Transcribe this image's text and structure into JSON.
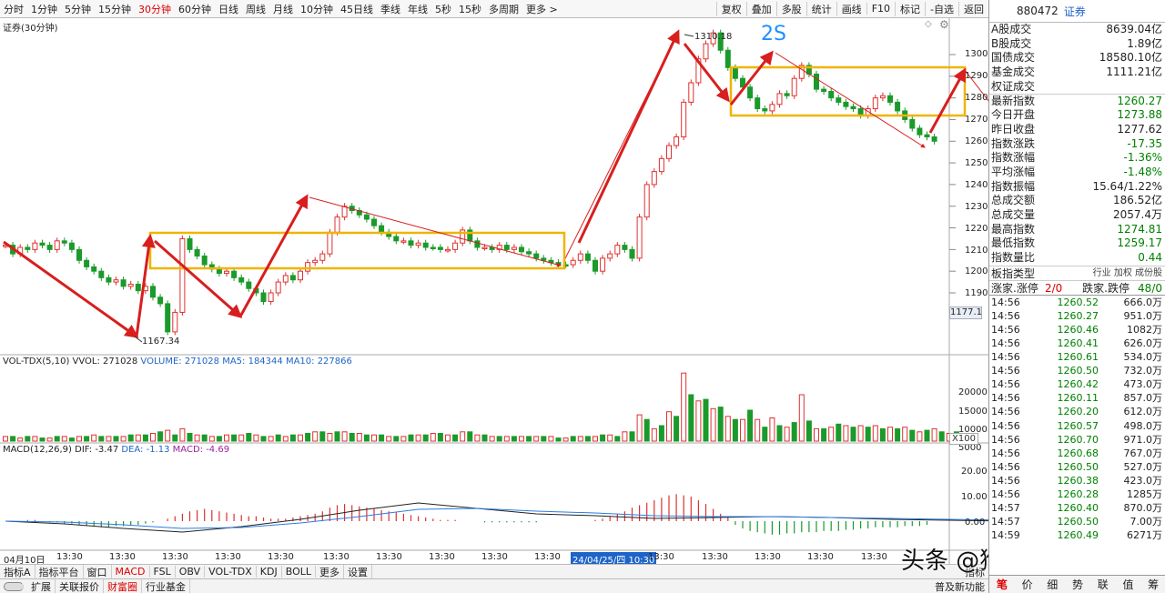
{
  "toolbar": {
    "timeframes": [
      "分时",
      "1分钟",
      "5分钟",
      "15分钟",
      "30分钟",
      "60分钟",
      "日线",
      "周线",
      "月线",
      "10分钟",
      "45日线",
      "季线",
      "年线",
      "5秒",
      "15秒",
      "多周期",
      "更多 >"
    ],
    "active_timeframe": "30分钟",
    "buttons": [
      "复权",
      "叠加",
      "多股",
      "统计",
      "画线",
      "F10",
      "标记",
      "-自选",
      "返回"
    ]
  },
  "main_chart": {
    "label": "证券(30分钟)",
    "high_label": "1310.18",
    "low_label": "1167.34",
    "annotation": "2S",
    "price_axis": [
      "1300",
      "1290",
      "1280",
      "1270",
      "1260",
      "1250",
      "1240",
      "1230",
      "1220",
      "1210",
      "1200",
      "1190"
    ],
    "current_price_tag": "1177.1"
  },
  "volume": {
    "label": "VOL-TDX(5,10)",
    "vvol": "VVOL: 271028",
    "volume": "VOLUME: 271028",
    "ma5": "MA5: 184344",
    "ma10": "MA10: 227866",
    "axis": [
      "20000",
      "15000",
      "10000",
      "5000"
    ],
    "unit": "X100"
  },
  "macd": {
    "label": "MACD(12,26,9)",
    "dif": "DIF: -3.47",
    "dea": "DEA: -1.13",
    "macd": "MACD: -4.69",
    "axis": [
      "20.00",
      "10.00",
      "0.00"
    ]
  },
  "time_axis": {
    "labels": [
      "04月10日",
      "13:30",
      "13:30",
      "13:30",
      "13:30",
      "13:30",
      "13:30",
      "13:30",
      "13:30",
      "13:30",
      "13:30",
      "24/04/25/四 10:30",
      "13:30",
      "13:30",
      "13:30",
      "13:30",
      "13:30"
    ]
  },
  "bottom_tabs": [
    "指标A",
    "指标平台",
    "窗口",
    "MACD",
    "FSL",
    "OBV",
    "VOL-TDX",
    "KDJ",
    "BOLL",
    "更多",
    "设置"
  ],
  "bottom_active": "MACD",
  "bottom_tabs2": [
    "扩展",
    "关联报价",
    "财富圈",
    "行业基金"
  ],
  "bottom_active2": "财富圈",
  "bottom_right": "普及新功能",
  "bottom_right2": "指标",
  "right_panel": {
    "code": "880472",
    "name": "证券",
    "stats": [
      {
        "label": "A股成交",
        "value": "8639.04亿",
        "c": ""
      },
      {
        "label": "B股成交",
        "value": "1.89亿",
        "c": ""
      },
      {
        "label": "国债成交",
        "value": "18580.10亿",
        "c": ""
      },
      {
        "label": "基金成交",
        "value": "1111.21亿",
        "c": ""
      },
      {
        "label": "权证成交",
        "value": "",
        "c": ""
      },
      {
        "label": "最新指数",
        "value": "1260.27",
        "c": "green"
      },
      {
        "label": "今日开盘",
        "value": "1273.88",
        "c": "green"
      },
      {
        "label": "昨日收盘",
        "value": "1277.62",
        "c": ""
      },
      {
        "label": "指数涨跌",
        "value": "-17.35",
        "c": "green"
      },
      {
        "label": "指数涨幅",
        "value": "-1.36%",
        "c": "green"
      },
      {
        "label": "平均涨幅",
        "value": "-1.48%",
        "c": "green"
      },
      {
        "label": "指数振幅",
        "value": "15.64/1.22%",
        "c": ""
      },
      {
        "label": "总成交额",
        "value": "186.52亿",
        "c": ""
      },
      {
        "label": "总成交量",
        "value": "2057.4万",
        "c": ""
      },
      {
        "label": "最高指数",
        "value": "1274.81",
        "c": "green"
      },
      {
        "label": "最低指数",
        "value": "1259.17",
        "c": "green"
      },
      {
        "label": "指数量比",
        "value": "0.44",
        "c": "green"
      }
    ],
    "board": {
      "label": "板指类型",
      "opts": "行业 加权 成份股"
    },
    "updown": {
      "a": "涨家.涨停",
      "av": "2/0",
      "b": "跌家.跌停",
      "bv": "48/0"
    },
    "ticks": [
      [
        "14:56",
        "1260.52",
        "666.0万"
      ],
      [
        "14:56",
        "1260.27",
        "951.0万"
      ],
      [
        "14:56",
        "1260.46",
        "1082万"
      ],
      [
        "14:56",
        "1260.41",
        "626.0万"
      ],
      [
        "14:56",
        "1260.61",
        "534.0万"
      ],
      [
        "14:56",
        "1260.50",
        "732.0万"
      ],
      [
        "14:56",
        "1260.42",
        "473.0万"
      ],
      [
        "14:56",
        "1260.11",
        "857.0万"
      ],
      [
        "14:56",
        "1260.20",
        "612.0万"
      ],
      [
        "14:56",
        "1260.57",
        "498.0万"
      ],
      [
        "14:56",
        "1260.70",
        "971.0万"
      ],
      [
        "14:56",
        "1260.68",
        "767.0万"
      ],
      [
        "14:56",
        "1260.50",
        "527.0万"
      ],
      [
        "14:56",
        "1260.38",
        "423.0万"
      ],
      [
        "14:56",
        "1260.28",
        "1285万"
      ],
      [
        "14:57",
        "1260.40",
        "870.0万"
      ],
      [
        "14:57",
        "1260.50",
        "7.00万"
      ],
      [
        "14:59",
        "1260.49",
        "6271万"
      ]
    ],
    "tabs": [
      "笔",
      "价",
      "细",
      "势",
      "联",
      "值",
      "筹"
    ],
    "active_tab": "笔"
  },
  "watermark": "头条 @猴哥聊缠论",
  "colors": {
    "up": "#e03030",
    "down": "#1a9a2a",
    "arrow": "#d81e1e",
    "box": "#f0b400",
    "dif": "#222",
    "dea": "#2a7de1"
  }
}
